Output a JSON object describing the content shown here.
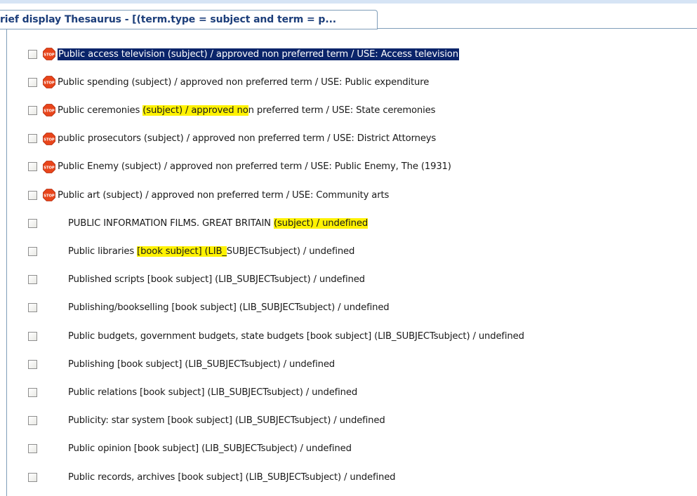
{
  "tab": {
    "title": "rief display Thesaurus - [(term.type = subject and term = p..."
  },
  "items": [
    {
      "selected": true,
      "stop_icon": true,
      "segments": [
        {
          "text": "Public access television (subject) / approved non preferred term / USE: Access television",
          "hl": false
        }
      ]
    },
    {
      "selected": false,
      "stop_icon": true,
      "segments": [
        {
          "text": "Public spending (subject) / approved non preferred term / USE: Public expenditure",
          "hl": false
        }
      ]
    },
    {
      "selected": false,
      "stop_icon": true,
      "segments": [
        {
          "text": "Public ceremonies ",
          "hl": false
        },
        {
          "text": "(subject) / approved no",
          "hl": true
        },
        {
          "text": "n preferred term / USE: State ceremonies",
          "hl": false
        }
      ]
    },
    {
      "selected": false,
      "stop_icon": true,
      "segments": [
        {
          "text": "public prosecutors (subject) / approved non preferred term / USE: District Attorneys",
          "hl": false
        }
      ]
    },
    {
      "selected": false,
      "stop_icon": true,
      "segments": [
        {
          "text": "Public Enemy (subject) / approved non preferred term / USE: Public Enemy, The (1931)",
          "hl": false
        }
      ]
    },
    {
      "selected": false,
      "stop_icon": true,
      "segments": [
        {
          "text": "Public art (subject) / approved non preferred term / USE: Community arts",
          "hl": false
        }
      ]
    },
    {
      "selected": false,
      "stop_icon": false,
      "segments": [
        {
          "text": "PUBLIC INFORMATION FILMS. GREAT BRITAIN ",
          "hl": false
        },
        {
          "text": "(subject) / undefined",
          "hl": true
        }
      ]
    },
    {
      "selected": false,
      "stop_icon": false,
      "segments": [
        {
          "text": "Public libraries ",
          "hl": false
        },
        {
          "text": "[book subject] (LIB_",
          "hl": true
        },
        {
          "text": "SUBJECTsubject) / undefined",
          "hl": false
        }
      ]
    },
    {
      "selected": false,
      "stop_icon": false,
      "segments": [
        {
          "text": "Published scripts [book subject] (LIB_SUBJECTsubject) / undefined",
          "hl": false
        }
      ]
    },
    {
      "selected": false,
      "stop_icon": false,
      "segments": [
        {
          "text": "Publishing/bookselling [book subject] (LIB_SUBJECTsubject) / undefined",
          "hl": false
        }
      ]
    },
    {
      "selected": false,
      "stop_icon": false,
      "segments": [
        {
          "text": "Public budgets, government budgets, state budgets [book subject] (LIB_SUBJECTsubject) / undefined",
          "hl": false
        }
      ]
    },
    {
      "selected": false,
      "stop_icon": false,
      "segments": [
        {
          "text": "Publishing [book subject] (LIB_SUBJECTsubject) / undefined",
          "hl": false
        }
      ]
    },
    {
      "selected": false,
      "stop_icon": false,
      "segments": [
        {
          "text": "Public relations [book subject] (LIB_SUBJECTsubject) / undefined",
          "hl": false
        }
      ]
    },
    {
      "selected": false,
      "stop_icon": false,
      "segments": [
        {
          "text": "Publicity: star system [book subject] (LIB_SUBJECTsubject) / undefined",
          "hl": false
        }
      ]
    },
    {
      "selected": false,
      "stop_icon": false,
      "segments": [
        {
          "text": "Public opinion [book subject] (LIB_SUBJECTsubject) / undefined",
          "hl": false
        }
      ]
    },
    {
      "selected": false,
      "stop_icon": false,
      "segments": [
        {
          "text": "Public records, archives [book subject] (LIB_SUBJECTsubject) / undefined",
          "hl": false
        }
      ]
    }
  ],
  "icons": {
    "stop": "stop-sign-icon",
    "checkbox": "checkbox"
  },
  "colors": {
    "selection": "#0a246a",
    "highlight": "#fff200",
    "stop": "#e8451b",
    "tab_title": "#1c3e7a"
  }
}
